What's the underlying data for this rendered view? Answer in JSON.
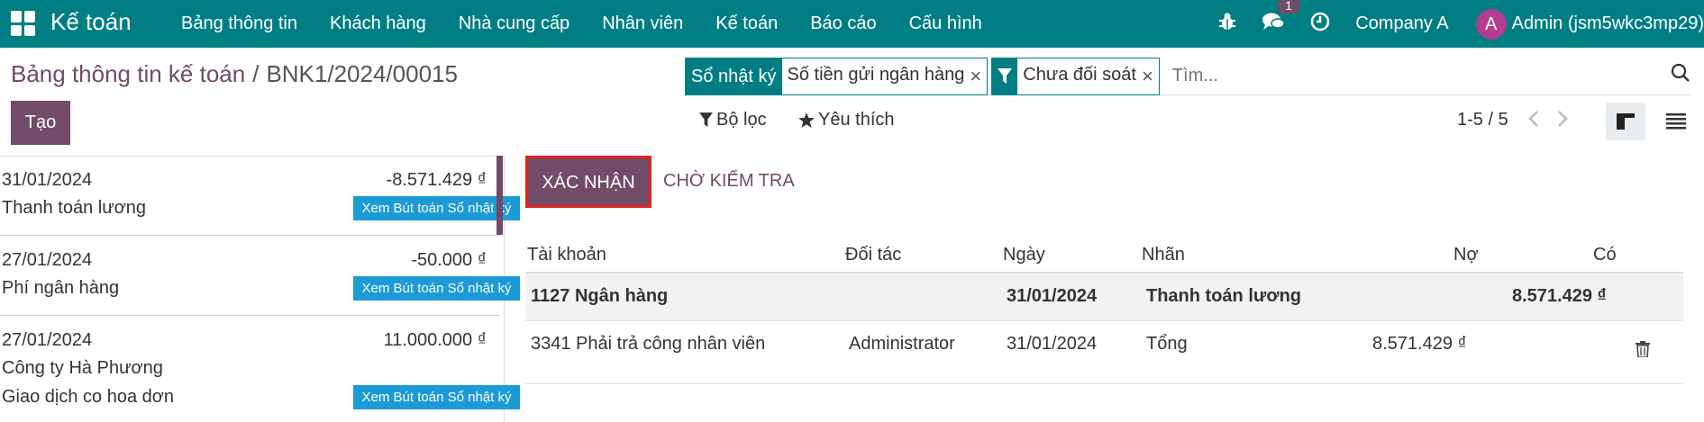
{
  "topbar": {
    "brand": "Kế toán",
    "menu": [
      "Bảng thông tin",
      "Khách hàng",
      "Nhà cung cấp",
      "Nhân viên",
      "Kế toán",
      "Báo cáo",
      "Cấu hình"
    ],
    "chat_badge": "1",
    "company": "Company A",
    "avatar_letter": "A",
    "user": "Admin (jsm5wkc3mp29)"
  },
  "breadcrumb": {
    "parent": "Bảng thông tin kế toán",
    "separator": "/",
    "current": "BNK1/2024/00015"
  },
  "create_label": "Tạo",
  "search": {
    "facets": [
      {
        "label": "Sổ nhật ký",
        "value": "Số tiền gửi ngân hàng",
        "remove": "×"
      },
      {
        "icon": "filter-icon",
        "value": "Chưa đối soát",
        "remove": "×"
      }
    ],
    "placeholder": "Tìm..."
  },
  "controls": {
    "filter_label": "Bộ lọc",
    "favorite_label": "Yêu thích",
    "pager": "1-5 / 5"
  },
  "records": [
    {
      "date": "31/01/2024",
      "amount": "-8.571.429 ₫",
      "partner": "Thanh toán lương",
      "ref": "",
      "link": "Xem Bút toán Sổ nhật ký"
    },
    {
      "date": "27/01/2024",
      "amount": "-50.000 ₫",
      "partner": "Phí ngân hàng",
      "ref": "",
      "link": "Xem Bút toán Sổ nhật ký"
    },
    {
      "date": "27/01/2024",
      "amount": "11.000.000 ₫",
      "partner": "Công ty Hà Phương",
      "ref": "Giao dịch co hoa dơn",
      "link": "Xem Bút toán Sổ nhật ký"
    }
  ],
  "actions": {
    "validate": "XÁC NHẬN",
    "to_review": "CHỜ KIỂM TRA"
  },
  "table": {
    "headers": {
      "account": "Tài khoản",
      "partner": "Đối tác",
      "date": "Ngày",
      "label": "Nhãn",
      "debit": "Nợ",
      "credit": "Có"
    },
    "rows": [
      {
        "account": "1127 Ngân hàng",
        "partner": "",
        "date": "31/01/2024",
        "label": "Thanh toán lương",
        "debit": "",
        "credit": "8.571.429 ₫"
      },
      {
        "account": "3341 Phải trả công nhân viên",
        "partner": "Administrator",
        "date": "31/01/2024",
        "label": "Tổng",
        "debit": "8.571.429 ₫",
        "credit": ""
      }
    ]
  },
  "colors": {
    "topbar": "#017e84",
    "primary": "#714b67",
    "link_badge": "#1c9ad6",
    "highlight_border": "#e2231a"
  }
}
